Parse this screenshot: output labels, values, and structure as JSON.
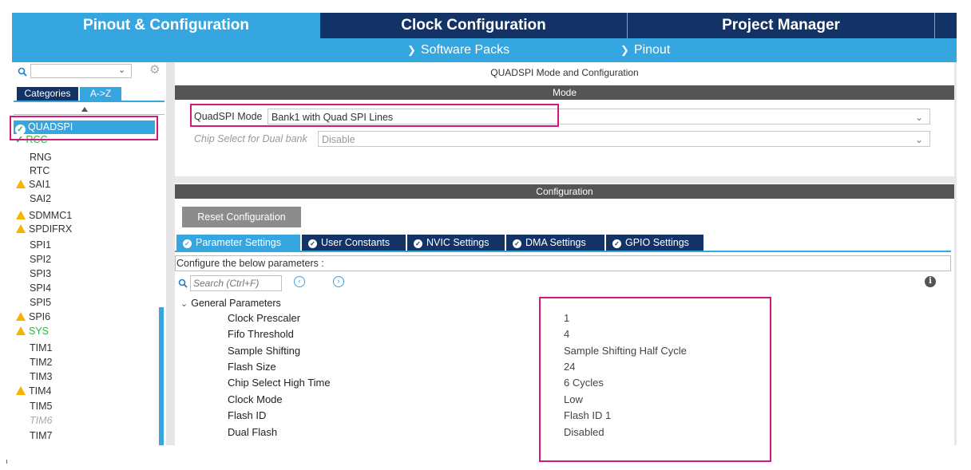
{
  "top_tabs": {
    "pinout": "Pinout & Configuration",
    "clock": "Clock Configuration",
    "project": "Project Manager"
  },
  "sub_menu": {
    "software_packs": "Software Packs",
    "pinout": "Pinout"
  },
  "sidebar": {
    "search_value": "",
    "tab_categories": "Categories",
    "tab_az": "A->Z",
    "items": [
      {
        "label": "QUADSPI",
        "status": "ok",
        "selected": true
      },
      {
        "label": "RCC",
        "status": "ok"
      },
      {
        "label": "RNG",
        "status": "none"
      },
      {
        "label": "RTC",
        "status": "none"
      },
      {
        "label": "SAI1",
        "status": "warning"
      },
      {
        "label": "SAI2",
        "status": "none"
      },
      {
        "label": "SDMMC1",
        "status": "warning"
      },
      {
        "label": "SPDIFRX",
        "status": "warning"
      },
      {
        "label": "SPI1",
        "status": "none"
      },
      {
        "label": "SPI2",
        "status": "none"
      },
      {
        "label": "SPI3",
        "status": "none"
      },
      {
        "label": "SPI4",
        "status": "none"
      },
      {
        "label": "SPI5",
        "status": "none"
      },
      {
        "label": "SPI6",
        "status": "warning"
      },
      {
        "label": "SYS",
        "status": "warning"
      },
      {
        "label": "TIM1",
        "status": "none"
      },
      {
        "label": "TIM2",
        "status": "none"
      },
      {
        "label": "TIM3",
        "status": "none"
      },
      {
        "label": "TIM4",
        "status": "warning"
      },
      {
        "label": "TIM5",
        "status": "none"
      },
      {
        "label": "TIM6",
        "status": "disabled"
      },
      {
        "label": "TIM7",
        "status": "none"
      }
    ]
  },
  "main": {
    "title": "QUADSPI Mode and Configuration",
    "mode_header": "Mode",
    "quadspi_mode_label": "QuadSPI Mode",
    "quadspi_mode_value": "Bank1 with Quad SPI Lines",
    "chip_select_label": "Chip Select for Dual bank",
    "chip_select_value": "Disable",
    "config_header": "Configuration",
    "reset_button": "Reset Configuration",
    "tabs": [
      "Parameter Settings",
      "User Constants",
      "NVIC Settings",
      "DMA Settings",
      "GPIO Settings"
    ],
    "configure_text": "Configure the below parameters :",
    "search_placeholder": "Search (Ctrl+F)",
    "group_label": "General Parameters",
    "params": [
      {
        "name": "Clock Prescaler",
        "value": "1"
      },
      {
        "name": "Fifo Threshold",
        "value": "4"
      },
      {
        "name": "Sample Shifting",
        "value": "Sample Shifting Half Cycle"
      },
      {
        "name": "Flash Size",
        "value": "24"
      },
      {
        "name": "Chip Select High Time",
        "value": "6 Cycles"
      },
      {
        "name": "Clock Mode",
        "value": "Low"
      },
      {
        "name": "Flash ID",
        "value": "Flash ID 1"
      },
      {
        "name": "Dual Flash",
        "value": "Disabled"
      }
    ]
  },
  "colors": {
    "dark_tab": "#133366",
    "accent": "#36a6e0",
    "highlight": "#d0197a",
    "warning": "#f4b400",
    "ok": "#2db34a"
  }
}
